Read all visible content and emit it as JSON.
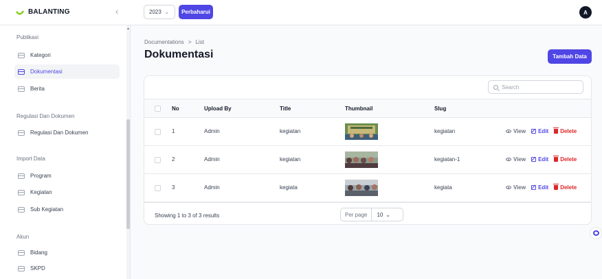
{
  "brand": {
    "name": "BALANTING"
  },
  "topbar": {
    "year": "2023",
    "update_label": "Perbaharui",
    "avatar_initial": "A"
  },
  "sidebar": {
    "groups": [
      {
        "title": "Publikasi",
        "items": [
          {
            "label": "Kategori"
          },
          {
            "label": "Dokumentasi",
            "active": true
          },
          {
            "label": "Berita"
          }
        ]
      },
      {
        "title": "Regulasi Dan Dokumen",
        "items": [
          {
            "label": "Regulasi Dan Dokumen"
          }
        ]
      },
      {
        "title": "Import Data",
        "items": [
          {
            "label": "Program"
          },
          {
            "label": "Kegiatan"
          },
          {
            "label": "Sub Kegiatan"
          }
        ]
      },
      {
        "title": "Akun",
        "items": [
          {
            "label": "Bidang"
          },
          {
            "label": "SKPD"
          }
        ]
      }
    ]
  },
  "page": {
    "breadcrumb": [
      "Documentations",
      ">",
      "List"
    ],
    "title": "Dokumentasi",
    "add_label": "Tambah Data"
  },
  "table": {
    "search_placeholder": "Search",
    "columns": [
      "No",
      "Upload By",
      "Title",
      "Thumbnail",
      "Slug"
    ],
    "rows": [
      {
        "no": "1",
        "upload_by": "Admin",
        "title": "kegiatan",
        "slug": "kegiatan"
      },
      {
        "no": "2",
        "upload_by": "Admin",
        "title": "kegiatan",
        "slug": "kegiatan-1"
      },
      {
        "no": "3",
        "upload_by": "Admin",
        "title": "kegiata",
        "slug": "kegiata"
      }
    ],
    "actions": {
      "view": "View",
      "edit": "Edit",
      "delete": "Delete"
    },
    "summary": "Showing 1 to 3 of 3 results",
    "per_page_label": "Per page",
    "per_page_value": "10"
  },
  "colors": {
    "primary": "#4f46e5",
    "danger": "#dc2626",
    "brand_green": "#84cc16"
  },
  "icons": [
    "chevron-left-icon",
    "chevron-down-icon",
    "folder-icon",
    "search-icon",
    "eye-icon",
    "edit-icon",
    "trash-icon",
    "chat-icon"
  ]
}
